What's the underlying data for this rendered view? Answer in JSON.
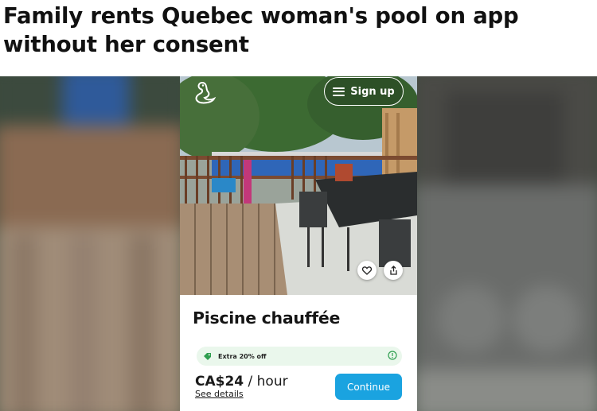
{
  "headline": "Family rents Quebec woman's pool on app without her consent",
  "app": {
    "logo_icon": "swan-logo-icon",
    "signup_label": "Sign up",
    "listing_title": "Piscine chauffée",
    "promo_text": "Extra 20% off",
    "price_amount": "CA$24",
    "price_unit": " / hour",
    "details_link": "See details",
    "continue_label": "Continue",
    "icons": [
      "menu-icon",
      "heart-icon",
      "share-icon",
      "tag-icon",
      "info-icon"
    ]
  },
  "colors": {
    "continue_button": "#1aa3e0",
    "promo_background": "#eaf7ec",
    "promo_accent": "#2e9e4f"
  }
}
